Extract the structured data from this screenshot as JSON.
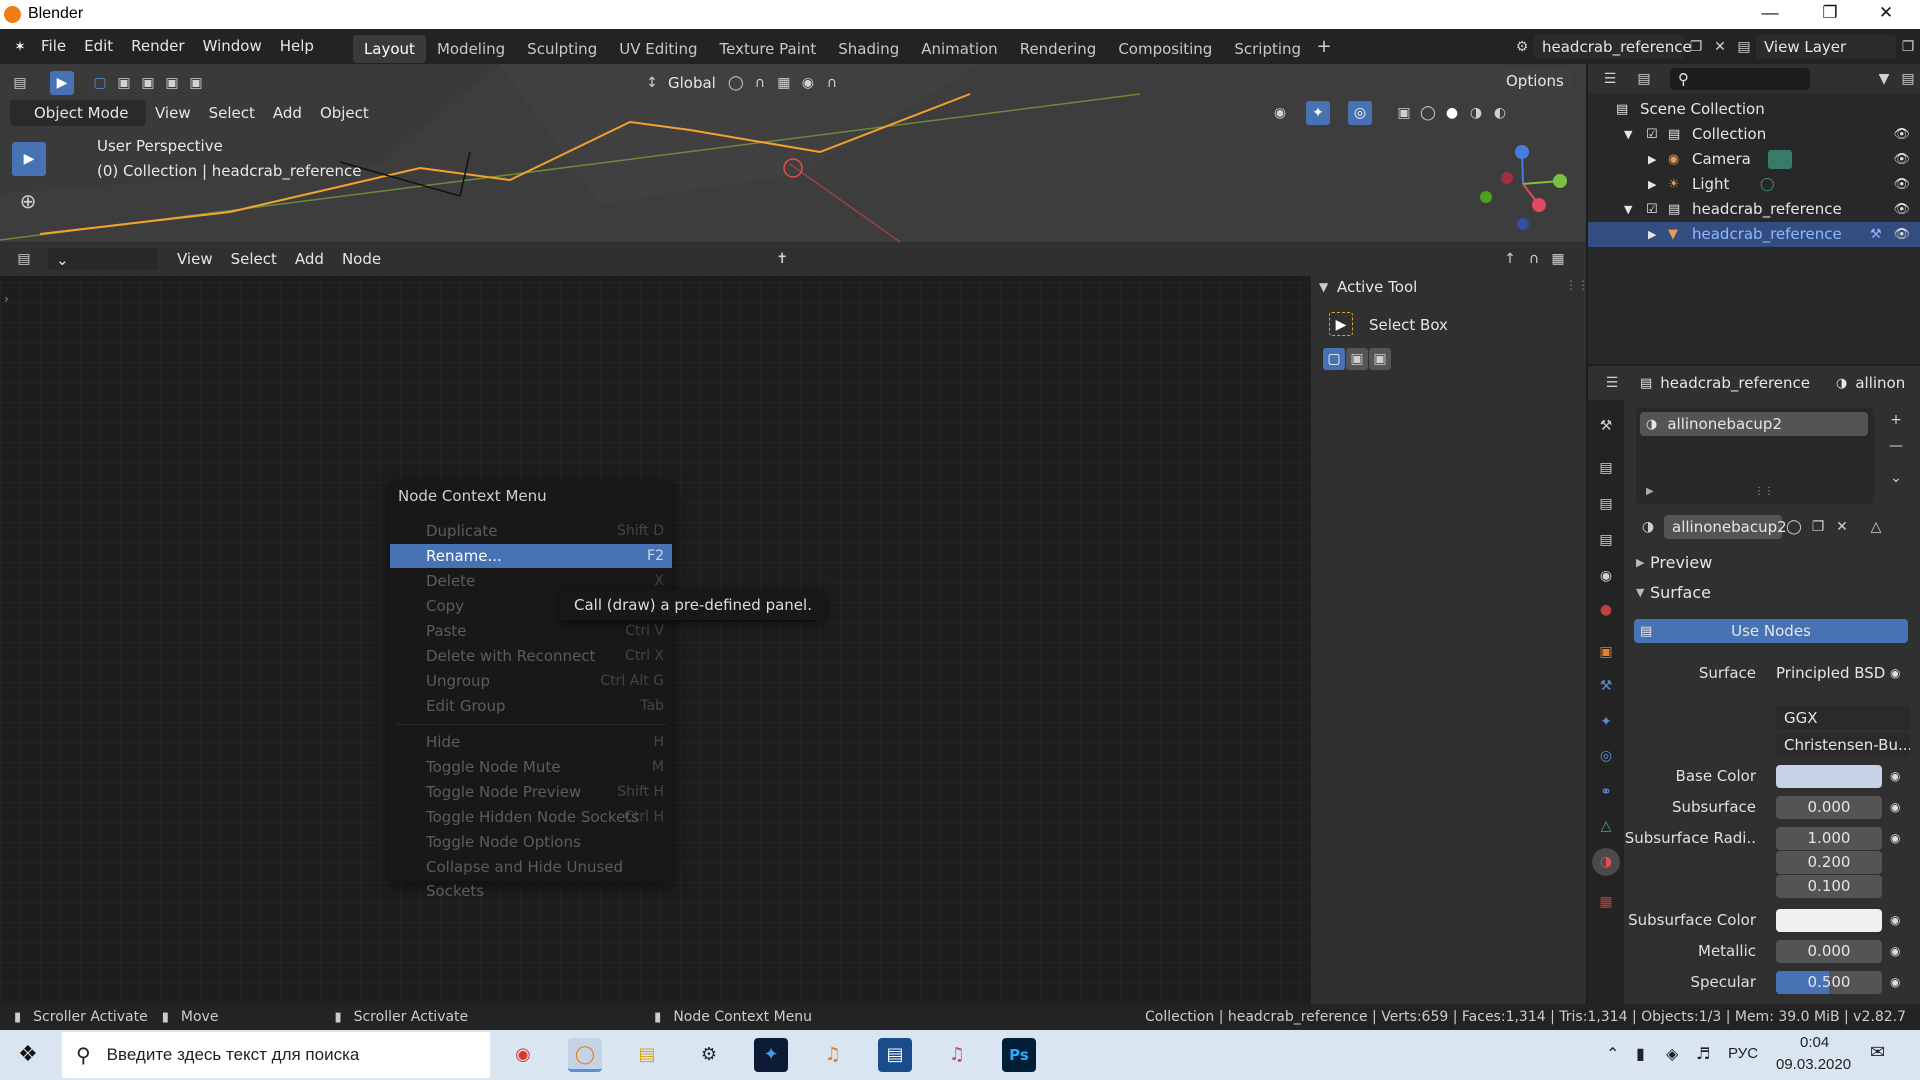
{
  "window": {
    "title": "Blender"
  },
  "menu": [
    "File",
    "Edit",
    "Render",
    "Window",
    "Help"
  ],
  "workspaces": [
    {
      "label": "Layout",
      "active": true
    },
    {
      "label": "Modeling"
    },
    {
      "label": "Sculpting"
    },
    {
      "label": "UV Editing"
    },
    {
      "label": "Texture Paint"
    },
    {
      "label": "Shading"
    },
    {
      "label": "Animation"
    },
    {
      "label": "Rendering"
    },
    {
      "label": "Compositing"
    },
    {
      "label": "Scripting"
    }
  ],
  "scene": {
    "name": "headcrab_reference",
    "view_layer": "View Layer"
  },
  "viewport": {
    "transform": "Global",
    "options": "Options",
    "mode": "Object Mode",
    "menu": [
      "View",
      "Select",
      "Add",
      "Object"
    ],
    "perspective": "User Perspective",
    "collection_info": "(0) Collection | headcrab_reference"
  },
  "node_editor": {
    "menu": [
      "View",
      "Select",
      "Add",
      "Node"
    ]
  },
  "active_tool": {
    "header": "Active Tool",
    "name": "Select Box"
  },
  "context_menu": {
    "title": "Node Context Menu",
    "items": [
      {
        "label": "Duplicate",
        "shortcut": "Shift D"
      },
      {
        "label": "Rename...",
        "shortcut": "F2",
        "highlighted": true
      },
      {
        "label": "Delete",
        "shortcut": "X"
      },
      {
        "label": "Copy",
        "shortcut": ""
      },
      {
        "label": "Paste",
        "shortcut": "Ctrl V"
      },
      {
        "label": "Delete with Reconnect",
        "shortcut": "Ctrl X"
      },
      {
        "label": "Ungroup",
        "shortcut": "Ctrl Alt G"
      },
      {
        "label": "Edit Group",
        "shortcut": "Tab"
      },
      {
        "label": "Hide",
        "shortcut": "H"
      },
      {
        "label": "Toggle Node Mute",
        "shortcut": "M"
      },
      {
        "label": "Toggle Node Preview",
        "shortcut": "Shift H"
      },
      {
        "label": "Toggle Hidden Node Sockets",
        "shortcut": "Ctrl H"
      },
      {
        "label": "Toggle Node Options",
        "shortcut": ""
      },
      {
        "label": "Collapse and Hide Unused Sockets",
        "shortcut": ""
      }
    ]
  },
  "tooltip": "Call (draw) a pre-defined panel.",
  "outliner": {
    "root": "Scene Collection",
    "items": [
      {
        "label": "Collection"
      },
      {
        "label": "Camera"
      },
      {
        "label": "Light"
      },
      {
        "label": "headcrab_reference"
      },
      {
        "label": "headcrab_reference",
        "selected": true
      }
    ]
  },
  "properties": {
    "object": "headcrab_reference",
    "material_short": "allinon",
    "slot": "allinonebacup2",
    "material": "allinonebacup2",
    "preview": "Preview",
    "surface_header": "Surface",
    "use_nodes": "Use Nodes",
    "rows": [
      {
        "label": "Surface",
        "value": "Principled BSD"
      },
      {
        "label": "",
        "value": "GGX"
      },
      {
        "label": "",
        "value": "Christensen-Bu..."
      },
      {
        "label": "Base Color",
        "value": ""
      },
      {
        "label": "Subsurface",
        "value": "0.000"
      },
      {
        "label": "Subsurface Radi..",
        "value": "1.000"
      },
      {
        "label": "",
        "value": "0.200"
      },
      {
        "label": "",
        "value": "0.100"
      },
      {
        "label": "Subsurface Color",
        "value": ""
      },
      {
        "label": "Metallic",
        "value": "0.000"
      },
      {
        "label": "Specular",
        "value": "0.500"
      }
    ],
    "specular_fraction": 0.5
  },
  "status": {
    "left1": "Scroller Activate",
    "left2": "Move",
    "mid": "Scroller Activate",
    "right_menu": "Node Context Menu",
    "stats": "Collection | headcrab_reference | Verts:659 | Faces:1,314 | Tris:1,314 | Objects:1/3 | Mem: 39.0 MiB | v2.82.7"
  },
  "taskbar": {
    "search": "Введите здесь текст для поиска",
    "lang": "РУС",
    "time": "0:04",
    "date": "09.03.2020",
    "ps": "Ps"
  },
  "colors": {
    "accent": "#4772b3",
    "selected_row": "#334d80",
    "orange": "#f5a030"
  }
}
